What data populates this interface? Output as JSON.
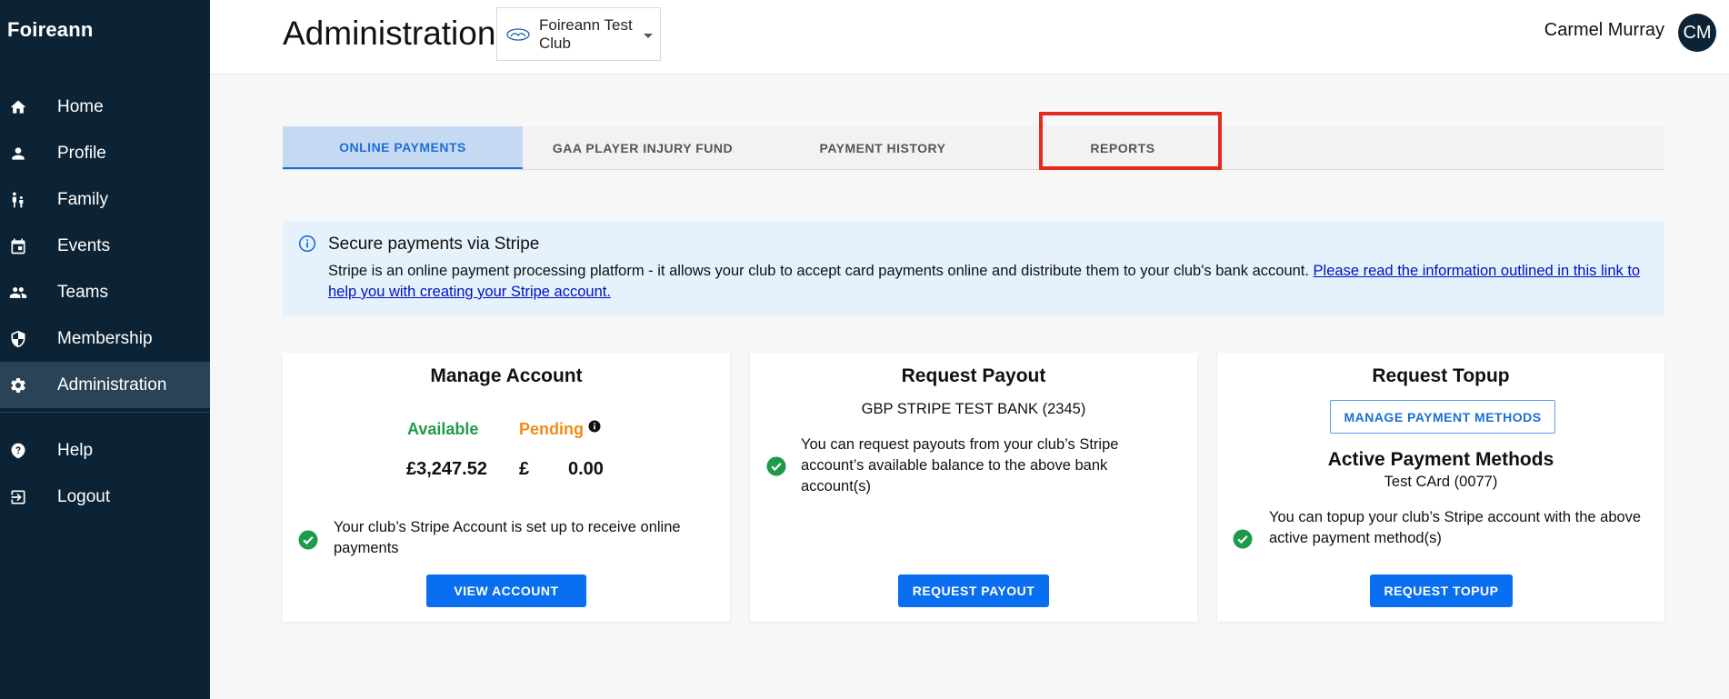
{
  "sidebar": {
    "brand": "Foireann",
    "items": [
      {
        "label": "Home",
        "icon": "home-icon"
      },
      {
        "label": "Profile",
        "icon": "person-icon"
      },
      {
        "label": "Family",
        "icon": "family-icon"
      },
      {
        "label": "Events",
        "icon": "calendar-icon"
      },
      {
        "label": "Teams",
        "icon": "group-icon"
      },
      {
        "label": "Membership",
        "icon": "shield-icon"
      },
      {
        "label": "Administration",
        "icon": "gear-icon",
        "active": true
      }
    ],
    "footer_items": [
      {
        "label": "Help",
        "icon": "help-icon"
      },
      {
        "label": "Logout",
        "icon": "logout-icon"
      }
    ]
  },
  "header": {
    "title": "Administration",
    "club_select": {
      "value": "Foireann Test Club",
      "crest_icon": "gaa-crest-icon"
    },
    "user_name": "Carmel Murray",
    "avatar_initials": "CM"
  },
  "tabs": [
    {
      "label": "ONLINE PAYMENTS",
      "active": true
    },
    {
      "label": "GAA PLAYER INJURY FUND"
    },
    {
      "label": "PAYMENT HISTORY"
    },
    {
      "label": "REPORTS"
    }
  ],
  "info_banner": {
    "title": "Secure payments via Stripe",
    "body": "Stripe is an online payment processing platform - it allows your club to accept card payments online and distribute them to your club's bank account. ",
    "link_text": "Please read the information outlined in this link to help you with creating your Stripe account."
  },
  "manage_account": {
    "title": "Manage Account",
    "available_label": "Available",
    "pending_label": "Pending",
    "available_amount": "£3,247.52",
    "pending_currency": "£",
    "pending_amount": "0.00",
    "status_text": "Your club’s Stripe Account is set up to receive online payments",
    "button": "VIEW ACCOUNT"
  },
  "request_payout": {
    "title": "Request Payout",
    "bank": "GBP STRIPE TEST BANK (2345)",
    "status_text": "You can request payouts from your club’s Stripe account’s available balance to the above bank account(s)",
    "button": "REQUEST PAYOUT"
  },
  "request_topup": {
    "title": "Request Topup",
    "manage_button": "MANAGE PAYMENT METHODS",
    "methods_title": "Active Payment Methods",
    "method": "Test CArd (0077)",
    "status_text": "You can topup your club’s Stripe account with the above active payment method(s)",
    "button": "REQUEST TOPUP"
  },
  "colors": {
    "sidebar_bg": "#0c2335",
    "primary": "#0a6ef0",
    "available": "#1e9b4a",
    "pending": "#ef8c12",
    "success": "#1e9b4a",
    "highlight": "#e52b21"
  }
}
